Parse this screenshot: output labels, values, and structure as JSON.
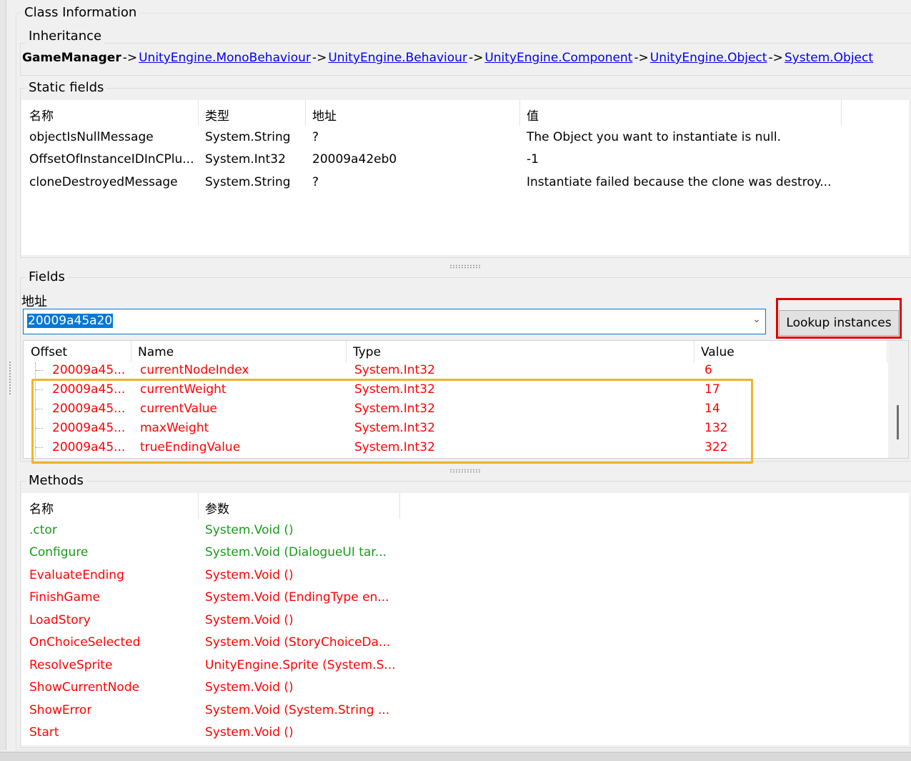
{
  "class_info": {
    "title": "Class Information",
    "inheritance": {
      "label": "Inheritance",
      "class_name": "GameManager",
      "separator": "->",
      "bases": [
        "UnityEngine.MonoBehaviour",
        "UnityEngine.Behaviour",
        "UnityEngine.Component",
        "UnityEngine.Object",
        "System.Object"
      ]
    },
    "static_fields": {
      "label": "Static fields",
      "headers": [
        "名称",
        "类型",
        "地址",
        "值"
      ],
      "rows": [
        [
          "objectIsNullMessage",
          "System.String",
          "?",
          "The Object you want to instantiate is null."
        ],
        [
          "OffsetOfInstanceIDInCPlu...",
          "System.Int32",
          "20009a42eb0",
          "-1"
        ],
        [
          "cloneDestroyedMessage",
          "System.String",
          "?",
          "Instantiate failed because the clone was destroy..."
        ]
      ]
    },
    "fields": {
      "label": "Fields",
      "address_label": "地址",
      "address_value": "20009a45a20",
      "lookup_button": "Lookup instances",
      "headers": [
        "Offset",
        "Name",
        "Type",
        "Value"
      ],
      "rows": [
        [
          "20009a45...",
          "currentNodeIndex",
          "System.Int32",
          "6"
        ],
        [
          "20009a45...",
          "currentWeight",
          "System.Int32",
          "17"
        ],
        [
          "20009a45...",
          "currentValue",
          "System.Int32",
          "14"
        ],
        [
          "20009a45...",
          "maxWeight",
          "System.Int32",
          "132"
        ],
        [
          "20009a45...",
          "trueEndingValue",
          "System.Int32",
          "322"
        ]
      ]
    },
    "methods": {
      "label": "Methods",
      "headers": [
        "名称",
        "参数"
      ],
      "rows": [
        {
          "name": ".ctor",
          "params": "System.Void ()",
          "color": "green"
        },
        {
          "name": "Configure",
          "params": "System.Void (DialogueUI tar...",
          "color": "green"
        },
        {
          "name": "EvaluateEnding",
          "params": "System.Void ()",
          "color": "red"
        },
        {
          "name": "FinishGame",
          "params": "System.Void (EndingType en...",
          "color": "red"
        },
        {
          "name": "LoadStory",
          "params": "System.Void ()",
          "color": "red"
        },
        {
          "name": "OnChoiceSelected",
          "params": "System.Void (StoryChoiceDa...",
          "color": "red"
        },
        {
          "name": "ResolveSprite",
          "params": "UnityEngine.Sprite (System.S...",
          "color": "red"
        },
        {
          "name": "ShowCurrentNode",
          "params": "System.Void ()",
          "color": "red"
        },
        {
          "name": "ShowError",
          "params": "System.Void (System.String ...",
          "color": "red"
        },
        {
          "name": "Start",
          "params": "System.Void ()",
          "color": "red"
        }
      ]
    }
  },
  "colors": {
    "link": "#0000ee",
    "field_text": "#ff0000",
    "method_public": "#1a9b1a",
    "method_private": "#ff0000",
    "highlight_red": "#e00000",
    "highlight_orange": "#f0b429",
    "selection": "#0078d7"
  }
}
